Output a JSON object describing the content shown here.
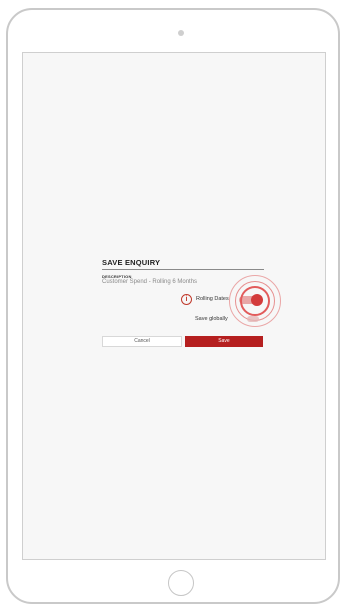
{
  "dialog": {
    "title": "SAVE ENQUIRY",
    "description_label": "DESCRIPTION",
    "description_value": "Customer Spend - Rolling 6 Months",
    "rolling_dates_label": "Rolling Dates",
    "rolling_dates_enabled": true,
    "save_globally_label": "Save globally",
    "save_globally_enabled": false,
    "info_icon_glyph": "i",
    "cancel_label": "Cancel",
    "save_label": "Save"
  },
  "colors": {
    "accent": "#b51f1f",
    "toggle_on": "#d33b3b",
    "ripple": "#e25b5b"
  },
  "icons": {
    "info": "info-icon"
  }
}
